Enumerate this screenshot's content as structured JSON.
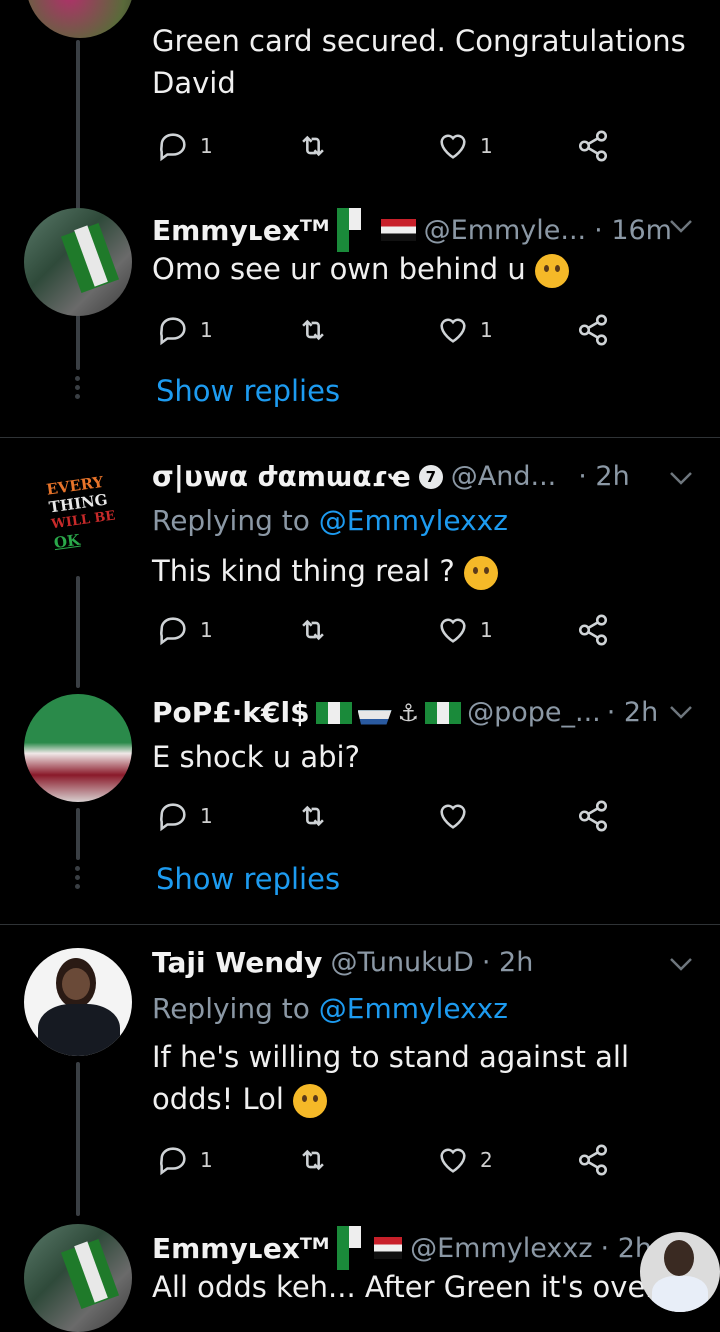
{
  "tweets": [
    {
      "body": "Green card secured. Congratulations David",
      "reply_count": "1",
      "like_count": "1"
    },
    {
      "name": "Emmyʟexᵀᴹ",
      "handle": "@Emmyle...",
      "time": "· 16m",
      "body": "Omo see ur own behind u",
      "reply_count": "1",
      "like_count": "1",
      "show_replies": "Show replies"
    },
    {
      "name": "σ|υwα ժαmաαɾҽ",
      "verified_number": "7",
      "handle": "@And...",
      "time": "· 2h",
      "replying_prefix": "Replying to",
      "replying_handle": "@Emmylexxz",
      "body": "This kind thing real ?",
      "reply_count": "1",
      "like_count": "1",
      "avatar_text": [
        "EVERY",
        "THING",
        "WILL BE",
        "OK"
      ]
    },
    {
      "name": "PoP£·k€l$",
      "handle": "@pope_...",
      "time": "· 2h",
      "body": "E shock u abi?",
      "reply_count": "1",
      "like_count": "",
      "show_replies": "Show replies"
    },
    {
      "name": "Taji Wendy",
      "handle": "@TunukuD",
      "time": "· 2h",
      "replying_prefix": "Replying to",
      "replying_handle": "@Emmylexxz",
      "body": "If he's willing to stand against all odds! Lol",
      "reply_count": "1",
      "like_count": "2"
    },
    {
      "name": "Emmyʟexᵀᴹ",
      "handle": "@Emmylexxz",
      "time": "· 2h",
      "body": "All odds keh... After Green it's over"
    }
  ],
  "colors": {
    "accent": "#1d9bf0",
    "muted": "#8b98a5",
    "background": "#000000"
  },
  "icons": [
    "reply-icon",
    "retweet-icon",
    "like-icon",
    "share-icon",
    "chevron-down-icon"
  ]
}
